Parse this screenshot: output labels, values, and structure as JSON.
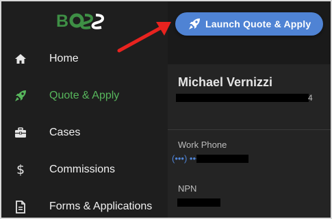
{
  "logo": {
    "text": "BOSS"
  },
  "sidebar": {
    "items": [
      {
        "label": "Home",
        "icon": "home-icon",
        "active": false
      },
      {
        "label": "Quote & Apply",
        "icon": "rocket-icon",
        "active": true
      },
      {
        "label": "Cases",
        "icon": "briefcase-icon",
        "active": false
      },
      {
        "label": "Commissions",
        "icon": "dollar-icon",
        "active": false
      },
      {
        "label": "Forms & Applications",
        "icon": "document-icon",
        "active": false
      }
    ]
  },
  "topbar": {
    "launch_label": "Launch Quote & Apply",
    "launch_icon": "rocket-icon"
  },
  "profile": {
    "name": "Michael Vernizzi",
    "email_partial": "4",
    "work_phone_label": "Work Phone",
    "work_phone_partial": "(•••) •••",
    "npn_label": "NPN"
  },
  "colors": {
    "accent_green": "#57b65c",
    "button_blue": "#4f83d4",
    "annotation_red": "#e8231f"
  }
}
